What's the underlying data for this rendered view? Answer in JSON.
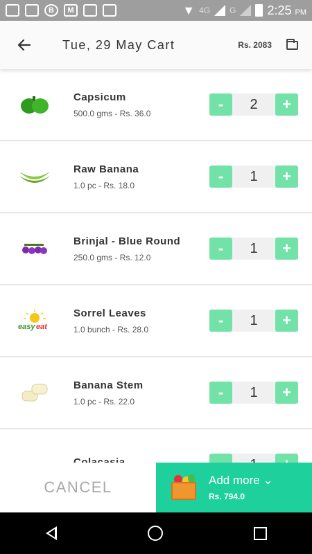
{
  "status_bar": {
    "net1": "4G",
    "net2": "G",
    "time": "2:25",
    "ampm": "PM"
  },
  "app_bar": {
    "title": "Tue, 29 May Cart",
    "total": "Rs. 2083"
  },
  "items": [
    {
      "name": "Capsicum",
      "meta": "500.0 gms - Rs. 36.0",
      "qty": "2"
    },
    {
      "name": "Raw Banana",
      "meta": "1.0 pc - Rs. 18.0",
      "qty": "1"
    },
    {
      "name": "Brinjal - Blue Round",
      "meta": "250.0 gms - Rs. 12.0",
      "qty": "1"
    },
    {
      "name": "Sorrel Leaves",
      "meta": "1.0 bunch - Rs. 28.0",
      "qty": "1"
    },
    {
      "name": "Banana Stem",
      "meta": "1.0 pc - Rs. 22.0",
      "qty": "1"
    },
    {
      "name": "Colacasia",
      "meta": "",
      "qty": "1"
    }
  ],
  "stepper": {
    "minus": "-",
    "plus": "+"
  },
  "bottom": {
    "cancel": "CANCEL",
    "add_more": "Add more",
    "add_amount": "Rs. 794.0",
    "chevron": "⌄"
  },
  "logo_text": "easy eat",
  "colors": {
    "accent": "#1ed09c",
    "stepper": "#72e2a8"
  }
}
